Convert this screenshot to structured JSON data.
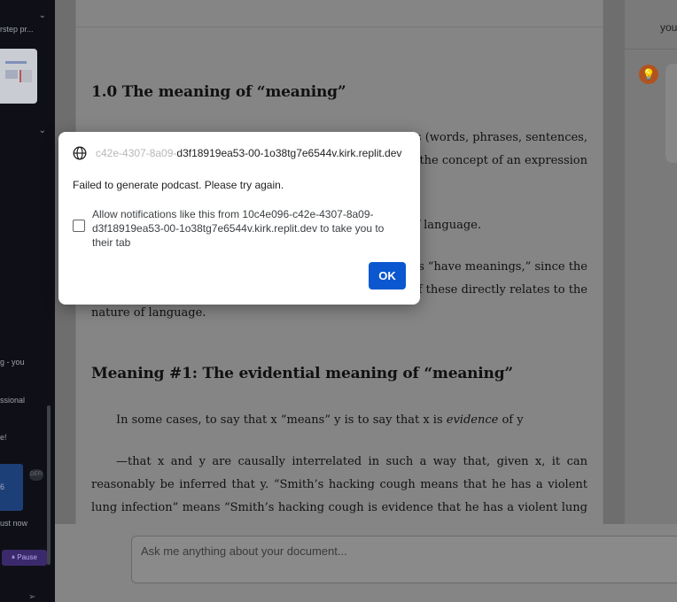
{
  "sidebar": {
    "item1": "rstep pr...",
    "text_you": "g - you",
    "text_professional": "ssional",
    "text_e": "e!",
    "card_value": "6",
    "badge": "DEFI",
    "just_now": "ust now",
    "pause_label": "Pause"
  },
  "document": {
    "heading1": "1.0 The meaning of “meaning”",
    "para1_line1": "ns (words, phrases, sentences,",
    "para1_line2": ", the concept of an expression",
    "para2": "concept of language.",
    "para3_line1": "es “have meanings,” since the",
    "para3_line2": "of these directly relates to the",
    "para3_line3": "nature of language.",
    "heading2": "Meaning #1: The evidential meaning of “meaning”",
    "para4_pre": "In some cases, to say that x “means” y is to say that x is ",
    "para4_em": "evidence",
    "para4_post": " of y",
    "para5": "—that x and y are causally interrelated in such a way that, given x, it can reasonably be inferred that y. “Smith’s hacking cough means that he has a violent lung infection” means “Smith’s hacking cough is evidence that he has a violent lung infection.” And the latter"
  },
  "right_panel": {
    "user_text": "you",
    "assistant_icon": "lightbulb-icon"
  },
  "composer": {
    "placeholder": "Ask me anything about your document..."
  },
  "dialog": {
    "origin_faded": "c42e-4307-8a09-",
    "origin_rest": "d3f18919ea53-00-1o38tg7e6544v.kirk.replit.dev",
    "message": "Failed to generate podcast. Please try again.",
    "checkbox_label": "Allow notifications like this from 10c4e096-c42e-4307-8a09-d3f18919ea53-00-1o38tg7e6544v.kirk.replit.dev to take you to their tab",
    "ok_label": "OK"
  },
  "colors": {
    "ok_button": "#0b57d0",
    "assistant_icon_bg": "#b2531f",
    "pause_button": "#3b2a6b",
    "sidebar_bg": "#0f1017"
  }
}
